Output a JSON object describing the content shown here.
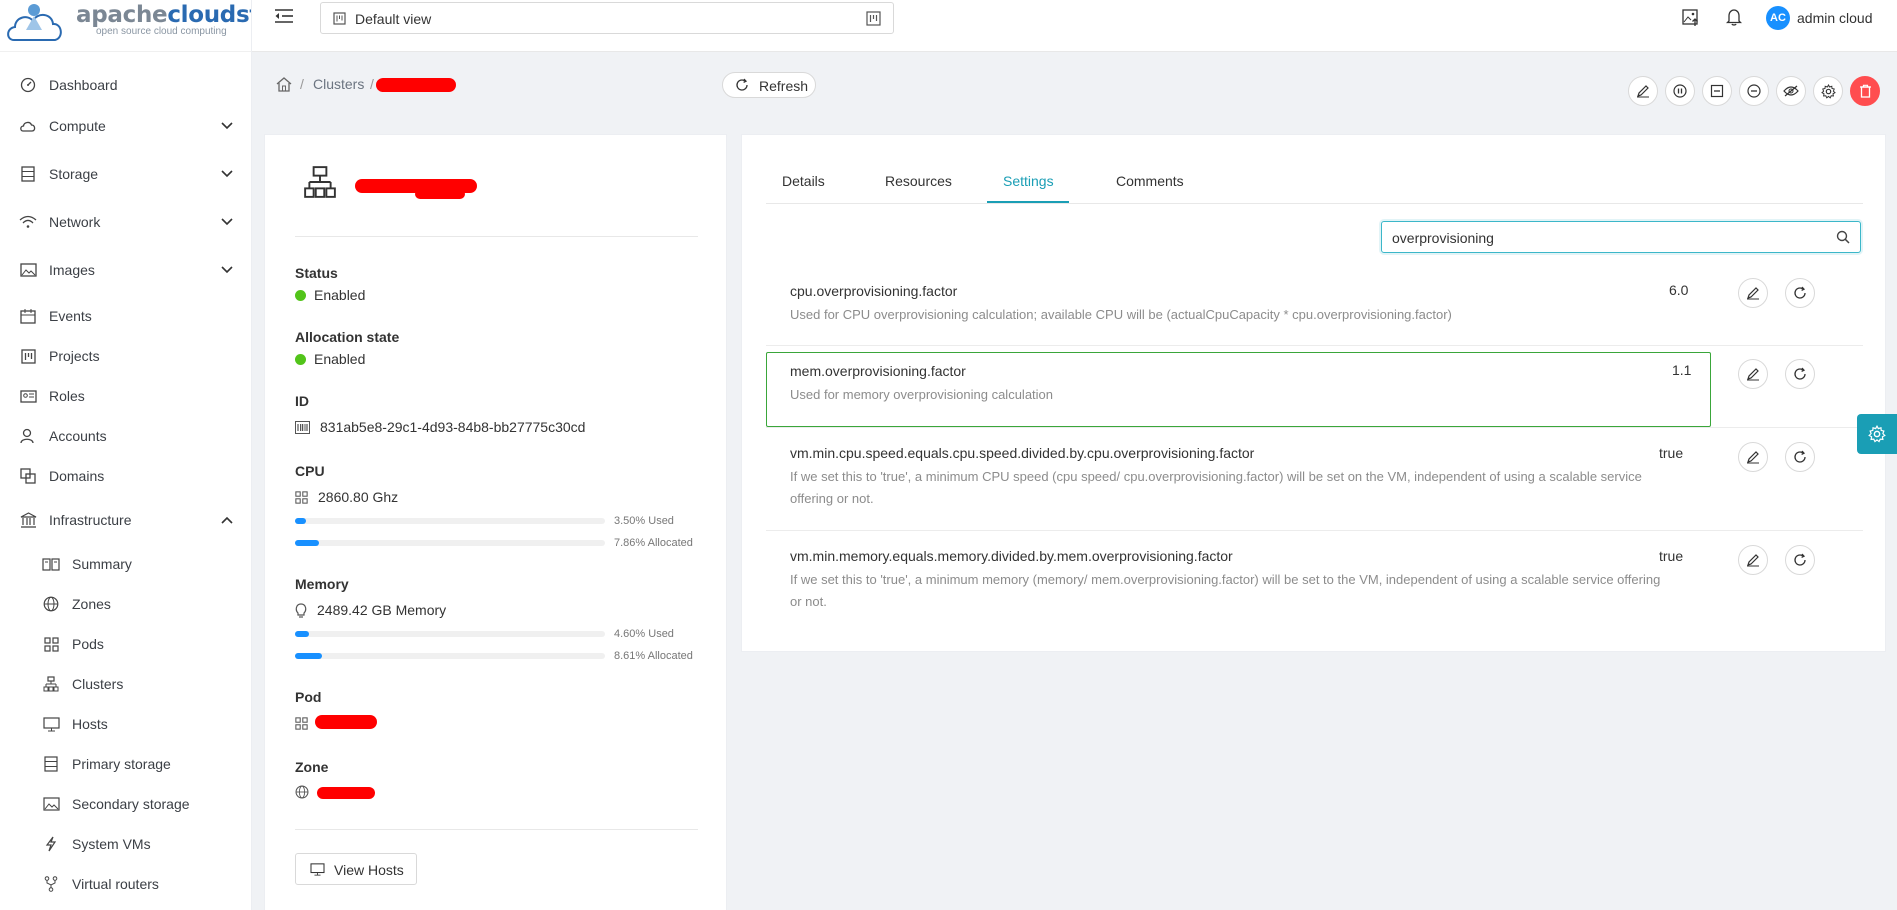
{
  "brand": {
    "name_light": "apache",
    "name_bold": "cloudstack",
    "tagline": "open source cloud computing"
  },
  "topbar": {
    "view": "Default view",
    "avatar_initials": "AC",
    "username": "admin cloud"
  },
  "sidebar": {
    "items": [
      {
        "label": "Dashboard",
        "icon": "dashboard-icon"
      },
      {
        "label": "Compute",
        "icon": "cloud-icon"
      },
      {
        "label": "Storage",
        "icon": "storage-icon"
      },
      {
        "label": "Network",
        "icon": "wifi-icon"
      },
      {
        "label": "Images",
        "icon": "image-icon"
      },
      {
        "label": "Events",
        "icon": "calendar-icon"
      },
      {
        "label": "Projects",
        "icon": "project-icon"
      },
      {
        "label": "Roles",
        "icon": "idcard-icon"
      },
      {
        "label": "Accounts",
        "icon": "user-icon"
      },
      {
        "label": "Domains",
        "icon": "block-icon"
      },
      {
        "label": "Infrastructure",
        "icon": "bank-icon"
      }
    ],
    "infra_items": [
      {
        "label": "Summary",
        "icon": "read-icon"
      },
      {
        "label": "Zones",
        "icon": "global-icon"
      },
      {
        "label": "Pods",
        "icon": "appstore-icon"
      },
      {
        "label": "Clusters",
        "icon": "cluster-icon"
      },
      {
        "label": "Hosts",
        "icon": "desktop-icon"
      },
      {
        "label": "Primary storage",
        "icon": "database-icon"
      },
      {
        "label": "Secondary storage",
        "icon": "picture-icon"
      },
      {
        "label": "System VMs",
        "icon": "thunderbolt-icon"
      },
      {
        "label": "Virtual routers",
        "icon": "fork-icon"
      }
    ]
  },
  "breadcrumb": {
    "clusters": "Clusters",
    "sep": "/",
    "refresh": "Refresh"
  },
  "details": {
    "status_label": "Status",
    "status_value": "Enabled",
    "allocation_label": "Allocation state",
    "allocation_value": "Enabled",
    "id_label": "ID",
    "id_value": "831ab5e8-29c1-4d93-84b8-bb27775c30cd",
    "cpu_label": "CPU",
    "cpu_value": "2860.80 Ghz",
    "cpu_used": "3.50% Used",
    "cpu_used_pct": 3.5,
    "cpu_allocated": "7.86% Allocated",
    "cpu_allocated_pct": 7.86,
    "memory_label": "Memory",
    "memory_value": "2489.42 GB Memory",
    "mem_used": "4.60% Used",
    "mem_used_pct": 4.6,
    "mem_allocated": "8.61% Allocated",
    "mem_allocated_pct": 8.61,
    "pod_label": "Pod",
    "zone_label": "Zone",
    "view_hosts": "View Hosts"
  },
  "tabs": [
    "Details",
    "Resources",
    "Settings",
    "Comments"
  ],
  "active_tab": "Settings",
  "search": {
    "value": "overprovisioning"
  },
  "settings": [
    {
      "name": "cpu.overprovisioning.factor",
      "description": "Used for CPU overprovisioning calculation; available CPU will be (actualCpuCapacity * cpu.overprovisioning.factor)",
      "value": "6.0"
    },
    {
      "name": "mem.overprovisioning.factor",
      "description": "Used for memory overprovisioning calculation",
      "value": "1.1"
    },
    {
      "name": "vm.min.cpu.speed.equals.cpu.speed.divided.by.cpu.overprovisioning.factor",
      "description": "If we set this to 'true', a minimum CPU speed (cpu speed/ cpu.overprovisioning.factor) will be set on the VM, independent of using a scalable service offering or not.",
      "value": "true"
    },
    {
      "name": "vm.min.memory.equals.memory.divided.by.mem.overprovisioning.factor",
      "description": "If we set this to 'true', a minimum memory (memory/ mem.overprovisioning.factor) will be set to the VM, independent of using a scalable service offering or not.",
      "value": "true"
    }
  ],
  "colors": {
    "accent": "#1a9eb5",
    "progress": "#1890ff",
    "enabled": "#52c41a",
    "danger": "#ff4d4f",
    "highlight": "#3aa63a",
    "redaction": "#ff0000"
  }
}
